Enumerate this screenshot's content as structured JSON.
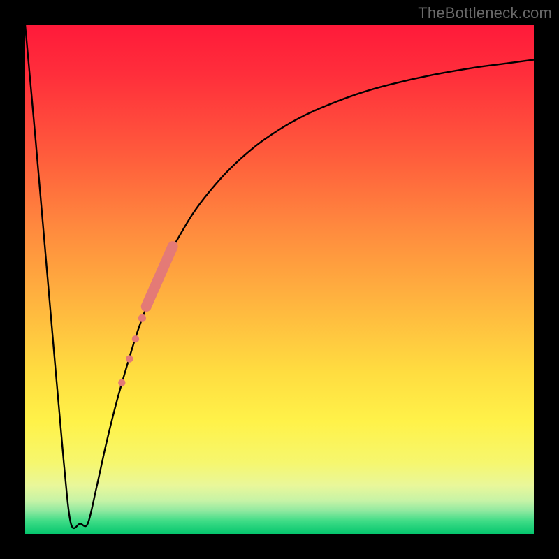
{
  "watermark": "TheBottleneck.com",
  "colors": {
    "frame": "#000000",
    "curve": "#000000",
    "marker": "#e47a76",
    "gradient_stops": [
      {
        "offset": 0.0,
        "color": "#ff1a3a"
      },
      {
        "offset": 0.1,
        "color": "#ff2f3b"
      },
      {
        "offset": 0.25,
        "color": "#ff5a3c"
      },
      {
        "offset": 0.4,
        "color": "#ff8a3e"
      },
      {
        "offset": 0.55,
        "color": "#ffb63f"
      },
      {
        "offset": 0.68,
        "color": "#ffdc40"
      },
      {
        "offset": 0.78,
        "color": "#fff249"
      },
      {
        "offset": 0.86,
        "color": "#f6f76e"
      },
      {
        "offset": 0.905,
        "color": "#e9f79a"
      },
      {
        "offset": 0.935,
        "color": "#c6f3a6"
      },
      {
        "offset": 0.955,
        "color": "#8fe9a0"
      },
      {
        "offset": 0.975,
        "color": "#3edc86"
      },
      {
        "offset": 1.0,
        "color": "#05c66e"
      }
    ]
  },
  "chart_data": {
    "type": "line",
    "title": "",
    "xlabel": "",
    "ylabel": "",
    "xlim": [
      0,
      100
    ],
    "ylim": [
      0,
      100
    ],
    "grid": false,
    "curve": {
      "name": "bottleneck-curve",
      "description": "V-shaped bottleneck curve: steep drop to near zero at x≈9, flat minimum, then asymptotic rise toward ~93",
      "x": [
        0,
        2,
        4,
        6,
        7.6,
        9.0,
        10.8,
        12.3,
        14,
        16,
        18,
        20,
        22,
        24,
        26,
        28,
        30,
        33,
        36,
        40,
        45,
        50,
        55,
        60,
        66,
        72,
        80,
        88,
        94,
        100
      ],
      "y": [
        100,
        78,
        55,
        32,
        14,
        2.0,
        2.0,
        2.0,
        9,
        18,
        26,
        33,
        39.5,
        45,
        50,
        54.3,
        58,
        63,
        67,
        71.5,
        76,
        79.5,
        82.3,
        84.5,
        86.7,
        88.4,
        90.2,
        91.6,
        92.4,
        93.2
      ]
    },
    "markers": {
      "name": "highlight-points",
      "color": "#e47a76",
      "points": [
        {
          "x": 19.0,
          "y": 29.7,
          "r": 5.2
        },
        {
          "x": 20.5,
          "y": 34.4,
          "r": 5.2
        },
        {
          "x": 21.7,
          "y": 38.3,
          "r": 5.2
        },
        {
          "x": 23.0,
          "y": 42.4,
          "r": 5.6
        }
      ],
      "thick_segment": {
        "x0": 23.8,
        "y0": 44.7,
        "x1": 29.0,
        "y1": 56.5,
        "width": 15
      }
    }
  }
}
